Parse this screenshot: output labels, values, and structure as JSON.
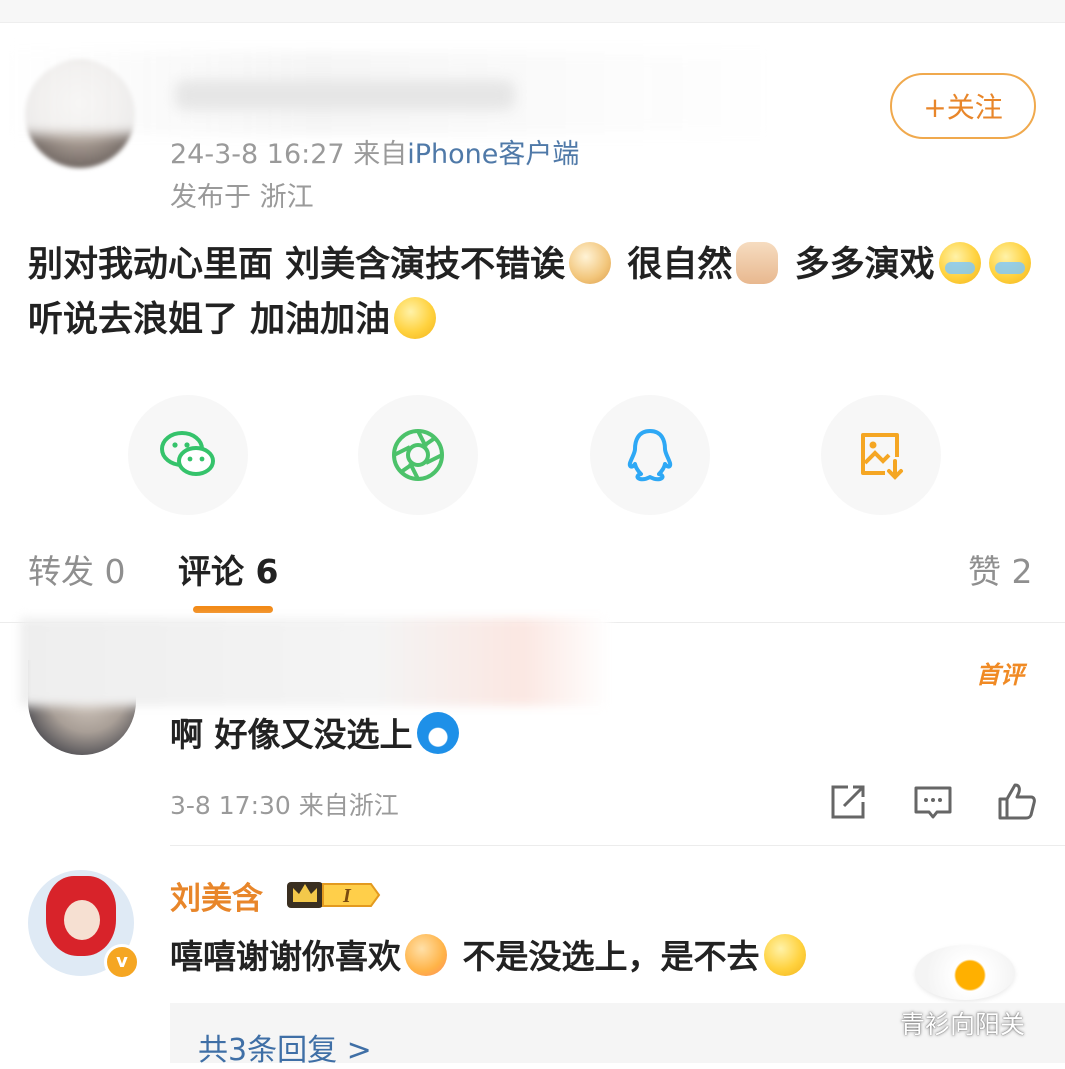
{
  "post": {
    "follow_label": "+关注",
    "timestamp": "24-3-8 16:27",
    "from_prefix": "来自",
    "source": "iPhone客户端",
    "location": "发布于 浙江",
    "text_parts": [
      "别对我动心里面 刘美含演技不错诶",
      "很自然",
      "多多演戏",
      "听说去浪姐了 加油加油"
    ],
    "emojis": [
      "doge-emoji",
      "thumbs-up-emoji",
      "touched-cry-emoji",
      "touched-cry-emoji",
      "laugh-emoji"
    ]
  },
  "share": {
    "icons": [
      "wechat-icon",
      "moments-icon",
      "qq-icon",
      "save-image-icon"
    ],
    "colors": {
      "wechat": "#35c36b",
      "moments": "#4cc26a",
      "qq": "#2ea8f5",
      "save": "#f5a623"
    }
  },
  "tabs": {
    "repost": "转发 0",
    "comments": "评论 6",
    "likes": "赞 2",
    "accent": "#f28a17"
  },
  "comment1": {
    "badge": "首评",
    "text": "啊 好像又没选上",
    "emoji": "doraemon-emoji",
    "meta": "3-8 17:30 来自浙江"
  },
  "comment2": {
    "name": "刘美含",
    "text_a": "嘻嘻谢谢你喜欢",
    "text_b": "不是没选上，是不去",
    "replies": "共3条回复 >",
    "verify": "v"
  },
  "watermark": "青衫向阳关"
}
